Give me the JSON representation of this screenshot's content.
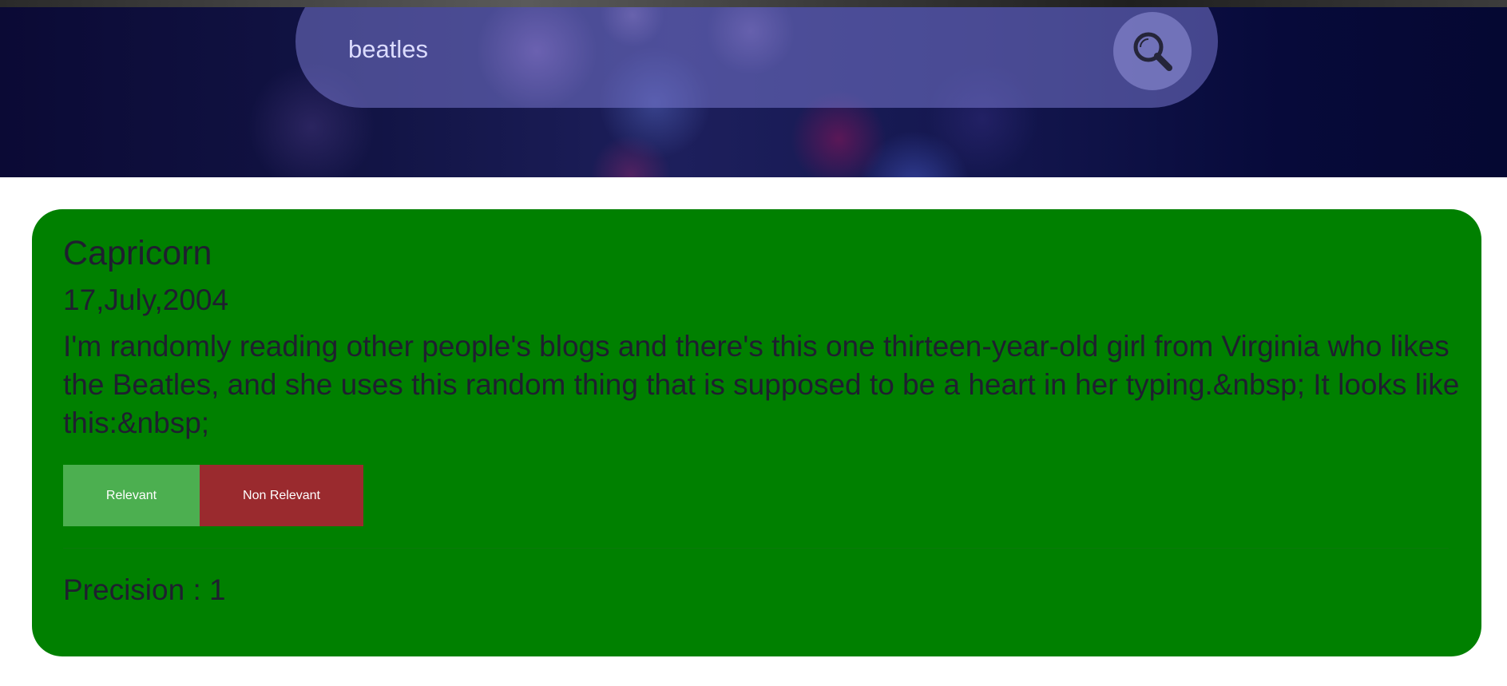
{
  "search": {
    "query": "beatles",
    "button_icon": "search-icon"
  },
  "result": {
    "title": "Capricorn",
    "date": "17,July,2004",
    "snippet": "I'm randomly reading other people's blogs and there's this one thirteen-year-old girl from Virginia who likes the Beatles, and she uses this random thing that is supposed to be a heart in her typing.&nbsp; It looks like this:&nbsp;",
    "relevant_label": "Relevant",
    "non_relevant_label": "Non Relevant",
    "precision_text": "Precision : 1",
    "card_color": "#008000",
    "relevant_color": "#4caf50",
    "non_relevant_color": "#9a2a2e"
  }
}
